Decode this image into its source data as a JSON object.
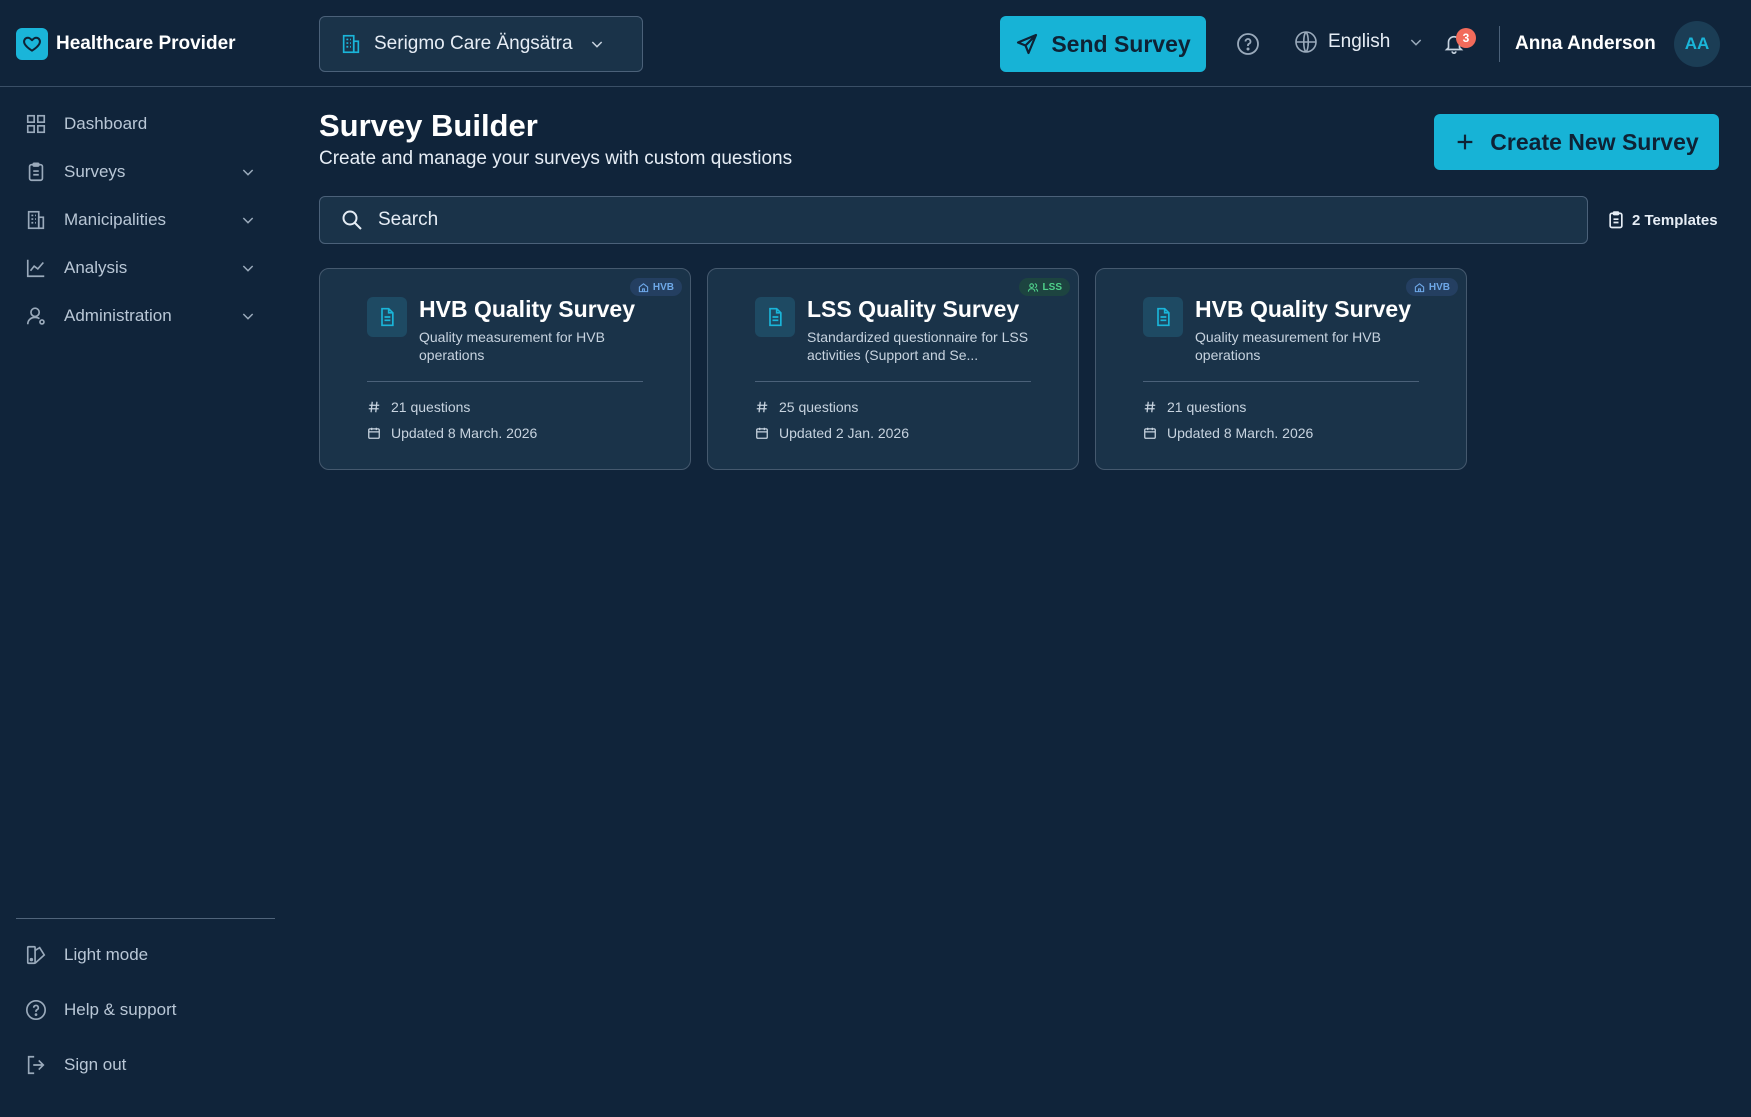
{
  "brand": {
    "name": "Healthcare Provider",
    "icon": "heart-icon",
    "color": "#1ab5d9"
  },
  "header": {
    "organization": "Serigmo Care Ängsätra",
    "send_button": "Send Survey",
    "language": "English",
    "notifications_count": "3",
    "user_name": "Anna Anderson",
    "user_initials": "AA"
  },
  "sidebar": {
    "items": [
      {
        "label": "Dashboard",
        "icon": "grid-icon"
      },
      {
        "label": "Surveys",
        "icon": "clipboard-icon"
      },
      {
        "label": "Manicipalities",
        "icon": "building-icon"
      },
      {
        "label": "Analysis",
        "icon": "chart-line-icon"
      },
      {
        "label": "Administration",
        "icon": "user-icon"
      }
    ],
    "bottom": [
      {
        "label": "Light mode",
        "icon": "theme-icon"
      },
      {
        "label": "Help & support",
        "icon": "help-icon"
      },
      {
        "label": "Sign out",
        "icon": "sign-out-icon"
      }
    ]
  },
  "main": {
    "title": "Survey Builder",
    "subtitle": "Create and manage your surveys with custom questions",
    "create_button": "Create New Survey",
    "search_placeholder": "Search",
    "templates_label": "2 Templates"
  },
  "cards": [
    {
      "badge": "HVB",
      "title": "HVB Quality Survey",
      "description": "Quality measurement for HVB operations",
      "questions": "21 questions",
      "updated": "Updated 8 March. 2026"
    },
    {
      "badge": "LSS",
      "title": "LSS Quality Survey",
      "description": "Standardized questionnaire for LSS activities (Support and Se...",
      "questions": "25 questions",
      "updated": "Updated 2 Jan. 2026"
    },
    {
      "badge": "HVB",
      "title": "HVB Quality Survey",
      "description": "Quality measurement for HVB operations",
      "questions": "21 questions",
      "updated": "Updated 8 March. 2026"
    }
  ],
  "colors": {
    "background": "#10243a",
    "surface": "#1a3349",
    "accent": "#17b3d6",
    "badge_hvb": "#6ea8e8",
    "badge_lss": "#4fd08a",
    "notification": "#f26b5b"
  }
}
